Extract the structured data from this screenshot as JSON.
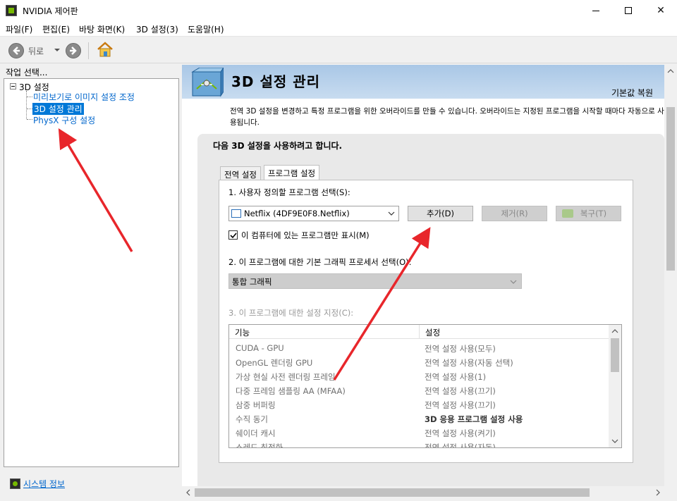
{
  "window": {
    "title": "NVIDIA 제어판"
  },
  "menu": [
    "파일(F)",
    "편집(E)",
    "바탕 화면(K)",
    "3D 설정(3)",
    "도움말(H)"
  ],
  "toolbar": {
    "back_label": "뒤로"
  },
  "left": {
    "header": "작업 선택...",
    "tree_root": "3D 설정",
    "tree_items": [
      "미리보기로 이미지 설정 조정",
      "3D 설정 관리",
      "PhysX 구성 설정"
    ],
    "selected_index": 1,
    "system_info": "시스템 정보"
  },
  "page": {
    "title": "3D 설정 관리",
    "restore_defaults": "기본값 복원",
    "description": "전역 3D 설정을 변경하고 특정 프로그램을 위한 오버라이드를 만들 수 있습니다. 오버라이드는 지정된 프로그램을 시작할 때마다 자동으로 사용됩니다.",
    "card_title": "다음 3D 설정을 사용하려고 합니다.",
    "tabs": [
      "전역 설정",
      "프로그램 설정"
    ],
    "active_tab": 1,
    "step1_label": "1. 사용자 정의할 프로그램 선택(S):",
    "program_selected": "Netflix (4DF9E0F8.Netflix)",
    "add_button": "추가(D)",
    "remove_button": "제거(R)",
    "restore_button": "복구(T)",
    "checkbox_label": "이 컴퓨터에 있는 프로그램만 표시(M)",
    "checkbox_checked": true,
    "step2_label": "2. 이 프로그램에 대한 기본 그래픽 프로세서 선택(O):",
    "gpu_selected": "통합 그래픽",
    "step3_label": "3. 이 프로그램에 대한 설정 지정(C):",
    "table_headers": [
      "기능",
      "설정"
    ],
    "table_rows": [
      {
        "feature": "CUDA - GPU",
        "setting": "전역 설정 사용(모두)",
        "bold": false
      },
      {
        "feature": "OpenGL 렌더링 GPU",
        "setting": "전역 설정 사용(자동 선택)",
        "bold": false
      },
      {
        "feature": "가상 현실 사전 렌더링 프레임",
        "setting": "전역 설정 사용(1)",
        "bold": false
      },
      {
        "feature": "다중 프레임 샘플링 AA (MFAA)",
        "setting": "전역 설정 사용(끄기)",
        "bold": false
      },
      {
        "feature": "삼중 버퍼링",
        "setting": "전역 설정 사용(끄기)",
        "bold": false
      },
      {
        "feature": "수직 동기",
        "setting": "3D 응용 프로그램 설정 사용",
        "bold": true
      },
      {
        "feature": "쉐이더 캐시",
        "setting": "전역 설정 사용(켜기)",
        "bold": false
      },
      {
        "feature": "스레드 최적화",
        "setting": "전역 설정 사용(자동)",
        "bold": false
      }
    ]
  },
  "colors": {
    "accent": "#0078d7",
    "annotation": "#e8262b",
    "nvidia_green": "#76b900",
    "header_band": "#b7d1ec"
  }
}
